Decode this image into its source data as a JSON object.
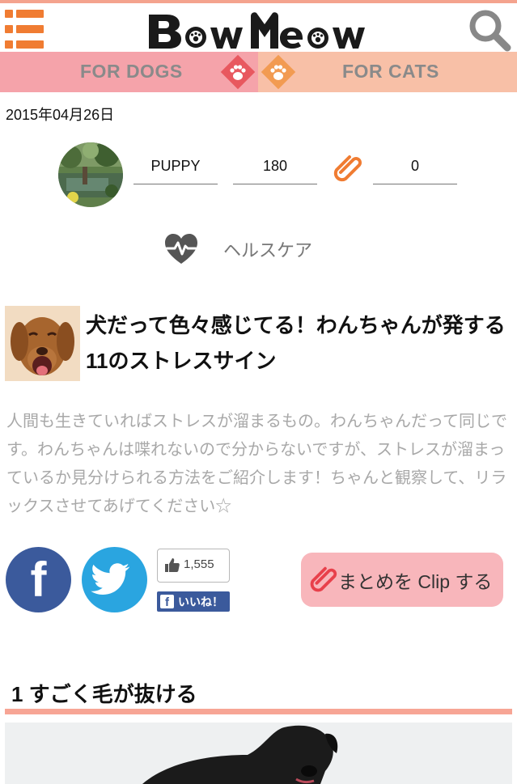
{
  "header": {
    "logo_text": "BowMeow",
    "menu_icon": "hamburger-menu-icon",
    "search_icon": "search-icon"
  },
  "category_tabs": {
    "dogs_label": "FOR DOGS",
    "cats_label": "FOR CATS",
    "paw_icon": "paw-icon"
  },
  "article": {
    "date": "2015年04月26日",
    "author": "PUPPY",
    "views": "180",
    "clips": "0",
    "category": "ヘルスケア",
    "title": "犬だって色々感じてる！わんちゃんが発する11のストレスサイン",
    "description": "人間も生きていればストレスが溜まるもの。わんちゃんだって同じです。わんちゃんは喋れないので分からないですが、ストレスが溜まっているか見分けられる方法をご紹介します！ちゃんと観察して、リラックスさせてあげてください☆"
  },
  "social": {
    "like_count": "1,555",
    "like_label": "いいね！",
    "facebook_letter": "f",
    "clip_button_label": "まとめを Clip する"
  },
  "sections": [
    {
      "title": "1 すごく毛が抜ける"
    }
  ],
  "colors": {
    "accent_orange": "#f07c32",
    "dogs_tab": "#f5a3aa",
    "cats_tab": "#f8c0a7",
    "facebook": "#3b5a9c",
    "twitter": "#2aa5e0",
    "clip_button": "#f8b6bb",
    "section_rule": "#f7a595"
  }
}
